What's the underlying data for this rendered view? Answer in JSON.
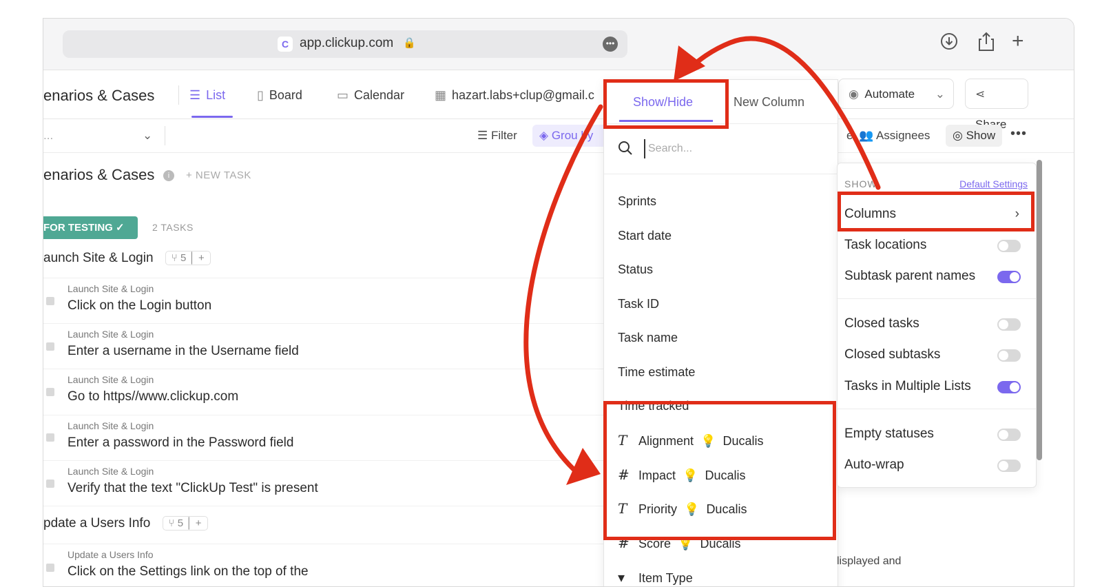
{
  "browser": {
    "url": "app.clickup.com",
    "favicon": "clickup-logo",
    "more_label": "•••"
  },
  "header": {
    "space_title": "enarios & Cases",
    "tabs": [
      {
        "label": "List",
        "icon": "list-icon",
        "active": true
      },
      {
        "label": "Board",
        "icon": "board-icon"
      },
      {
        "label": "Calendar",
        "icon": "calendar-icon"
      },
      {
        "label": "hazart.labs+clup@gmail.c",
        "icon": "table-icon"
      }
    ],
    "automate_label": "Automate",
    "share_label": "Share"
  },
  "filterbar": {
    "search_stub": "...",
    "filter_label": "Filter",
    "group_label": "Grou  by",
    "assignees_label": "Assignees",
    "assignees_prefix": "e",
    "show_label": "Show",
    "more_label": "•••"
  },
  "list": {
    "title": "enarios & Cases",
    "new_task_label": "+ NEW TASK",
    "status_label": "FOR TESTING",
    "task_count": "2 TASKS",
    "groups": [
      {
        "name": "aunch Site & Login",
        "subtask_count": "5",
        "tasks": [
          {
            "parent": "Launch Site & Login",
            "name": "Click on the Login button"
          },
          {
            "parent": "Launch Site & Login",
            "name": "Enter a username in the Username field"
          },
          {
            "parent": "Launch Site & Login",
            "name": "Go to https//www.clickup.com"
          },
          {
            "parent": "Launch Site & Login",
            "name": "Enter a password in the Password field"
          },
          {
            "parent": "Launch Site & Login",
            "name": "Verify that the text \"ClickUp Test\" is present"
          }
        ]
      },
      {
        "name": "pdate a Users Info",
        "subtask_count": "5",
        "tasks": [
          {
            "parent": "Update a Users Info",
            "name": "Click on the Settings link on the top of the"
          }
        ]
      }
    ]
  },
  "columns_panel": {
    "tab_showhide": "Show/Hide",
    "tab_newcolumn": "New Column",
    "search_placeholder": "Search...",
    "items": [
      "Sprints",
      "Start date",
      "Status",
      "Task ID",
      "Task name",
      "Time estimate",
      "Time tracked"
    ],
    "custom_fields": [
      {
        "type": "T",
        "name": "Alignment",
        "source": "Ducalis"
      },
      {
        "type": "#",
        "name": "Impact",
        "source": "Ducalis"
      },
      {
        "type": "T",
        "name": "Priority",
        "source": "Ducalis"
      },
      {
        "type": "#",
        "name": "Score",
        "source": "Ducalis"
      }
    ],
    "item_type_label": "Item Type"
  },
  "show_panel": {
    "heading": "SHOW",
    "default_settings": "Default Settings",
    "columns_label": "Columns",
    "options": [
      {
        "label": "Task locations",
        "on": false
      },
      {
        "label": "Subtask parent names",
        "on": true
      },
      {
        "label": "Closed tasks",
        "on": false
      },
      {
        "label": "Closed subtasks",
        "on": false
      },
      {
        "label": "Tasks in Multiple Lists",
        "on": true
      },
      {
        "label": "Empty statuses",
        "on": false
      },
      {
        "label": "Auto-wrap",
        "on": false
      }
    ],
    "hint": "lisplayed and"
  },
  "colors": {
    "accent": "#7b68ee",
    "status": "#4fa894",
    "annotation": "#e02d18"
  }
}
